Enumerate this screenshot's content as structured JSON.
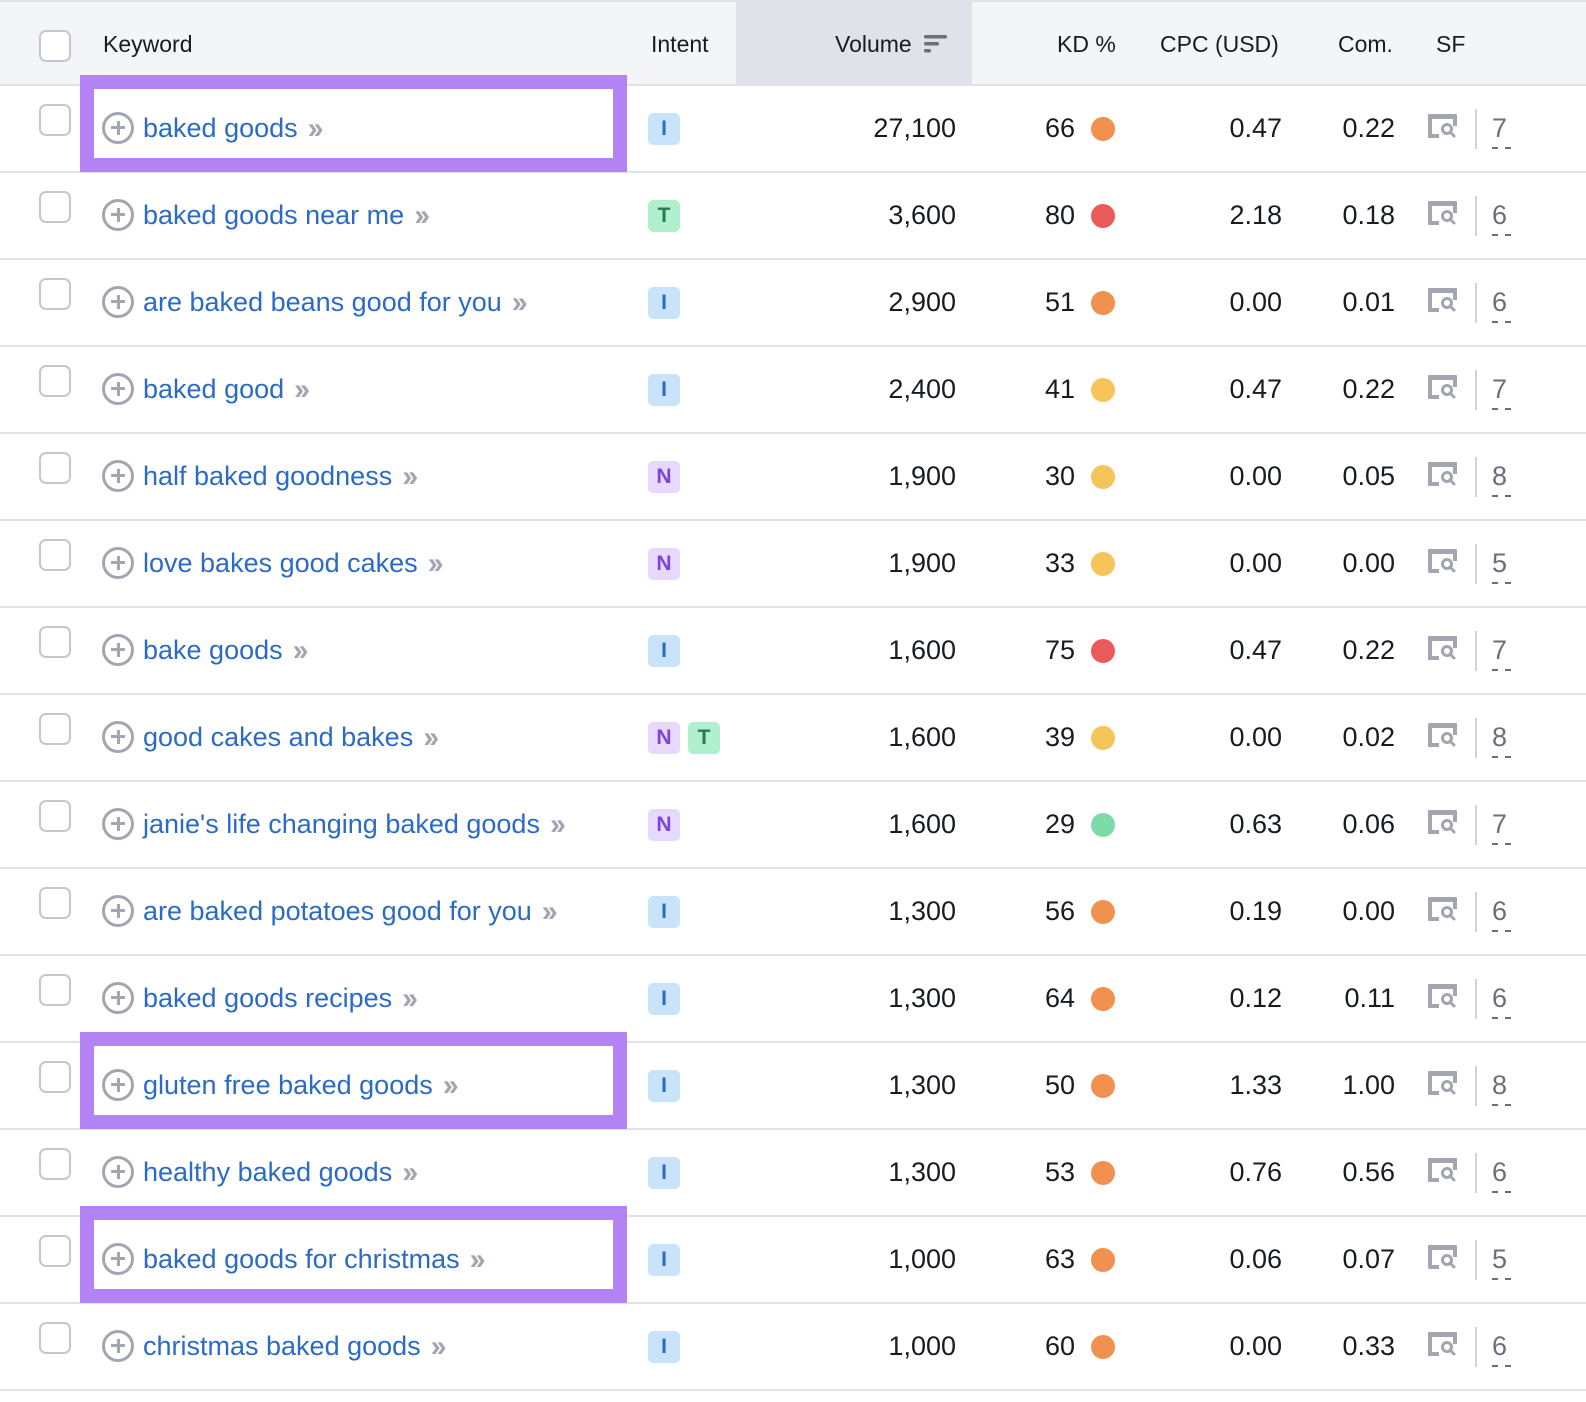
{
  "table": {
    "headers": {
      "keyword": "Keyword",
      "intent": "Intent",
      "volume": "Volume",
      "kd": "KD %",
      "cpc": "CPC (USD)",
      "com": "Com.",
      "sf": "SF"
    },
    "sorted_column": "volume",
    "rows": [
      {
        "keyword": "baked goods",
        "intents": [
          "I"
        ],
        "volume": "27,100",
        "kd": "66",
        "kd_color": "#f0914f",
        "cpc": "0.47",
        "com": "0.22",
        "sf": "7",
        "highlighted": true
      },
      {
        "keyword": "baked goods near me",
        "intents": [
          "T"
        ],
        "volume": "3,600",
        "kd": "80",
        "kd_color": "#eb5a5a",
        "cpc": "2.18",
        "com": "0.18",
        "sf": "6",
        "highlighted": false
      },
      {
        "keyword": "are baked beans good for you",
        "intents": [
          "I"
        ],
        "volume": "2,900",
        "kd": "51",
        "kd_color": "#f0914f",
        "cpc": "0.00",
        "com": "0.01",
        "sf": "6",
        "highlighted": false
      },
      {
        "keyword": "baked good",
        "intents": [
          "I"
        ],
        "volume": "2,400",
        "kd": "41",
        "kd_color": "#f5c45a",
        "cpc": "0.47",
        "com": "0.22",
        "sf": "7",
        "highlighted": false
      },
      {
        "keyword": "half baked goodness",
        "intents": [
          "N"
        ],
        "volume": "1,900",
        "kd": "30",
        "kd_color": "#f5c45a",
        "cpc": "0.00",
        "com": "0.05",
        "sf": "8",
        "highlighted": false
      },
      {
        "keyword": "love bakes good cakes",
        "intents": [
          "N"
        ],
        "volume": "1,900",
        "kd": "33",
        "kd_color": "#f5c45a",
        "cpc": "0.00",
        "com": "0.00",
        "sf": "5",
        "highlighted": false
      },
      {
        "keyword": "bake goods",
        "intents": [
          "I"
        ],
        "volume": "1,600",
        "kd": "75",
        "kd_color": "#eb5a5a",
        "cpc": "0.47",
        "com": "0.22",
        "sf": "7",
        "highlighted": false
      },
      {
        "keyword": "good cakes and bakes",
        "intents": [
          "N",
          "T"
        ],
        "volume": "1,600",
        "kd": "39",
        "kd_color": "#f5c45a",
        "cpc": "0.00",
        "com": "0.02",
        "sf": "8",
        "highlighted": false
      },
      {
        "keyword": "janie's life changing baked goods",
        "intents": [
          "N"
        ],
        "volume": "1,600",
        "kd": "29",
        "kd_color": "#7fdaa9",
        "cpc": "0.63",
        "com": "0.06",
        "sf": "7",
        "highlighted": false
      },
      {
        "keyword": "are baked potatoes good for you",
        "intents": [
          "I"
        ],
        "volume": "1,300",
        "kd": "56",
        "kd_color": "#f0914f",
        "cpc": "0.19",
        "com": "0.00",
        "sf": "6",
        "highlighted": false
      },
      {
        "keyword": "baked goods recipes",
        "intents": [
          "I"
        ],
        "volume": "1,300",
        "kd": "64",
        "kd_color": "#f0914f",
        "cpc": "0.12",
        "com": "0.11",
        "sf": "6",
        "highlighted": false
      },
      {
        "keyword": "gluten free baked goods",
        "intents": [
          "I"
        ],
        "volume": "1,300",
        "kd": "50",
        "kd_color": "#f0914f",
        "cpc": "1.33",
        "com": "1.00",
        "sf": "8",
        "highlighted": true
      },
      {
        "keyword": "healthy baked goods",
        "intents": [
          "I"
        ],
        "volume": "1,300",
        "kd": "53",
        "kd_color": "#f0914f",
        "cpc": "0.76",
        "com": "0.56",
        "sf": "6",
        "highlighted": false
      },
      {
        "keyword": "baked goods for christmas",
        "intents": [
          "I"
        ],
        "volume": "1,000",
        "kd": "63",
        "kd_color": "#f0914f",
        "cpc": "0.06",
        "com": "0.07",
        "sf": "5",
        "highlighted": true
      },
      {
        "keyword": "christmas baked goods",
        "intents": [
          "I"
        ],
        "volume": "1,000",
        "kd": "60",
        "kd_color": "#f0914f",
        "cpc": "0.00",
        "com": "0.33",
        "sf": "6",
        "highlighted": false
      }
    ]
  },
  "colors": {
    "highlight_border": "#b383f5",
    "link": "#2b6bc6"
  }
}
